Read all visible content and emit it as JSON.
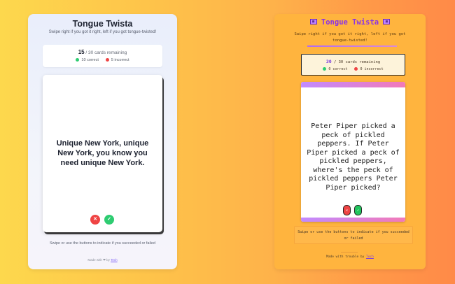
{
  "left": {
    "title": "Tongue Twista",
    "subtitle": "Swipe right if you got it right, left if you got tongue-twisted!",
    "stats": {
      "remaining_count": "15",
      "remaining_text": " / 30 cards remaining",
      "correct": "10 correct",
      "incorrect": "5 incorrect"
    },
    "card_text": "Unique New York, unique New York, you know you need unique New York.",
    "fail_symbol": "✕",
    "pass_symbol": "✓",
    "hint": "Swipe or use the buttons to indicate if you succeeded or failed",
    "footer_prefix": "Made with ",
    "footer_mid": "❤",
    "footer_text": " by ",
    "footer_link": "Tech"
  },
  "right": {
    "title": "Tongue Twista",
    "title_icon": "▦",
    "subtitle": "Swipe right if you got it right, left if you got tongue-twisted!",
    "progress": 1.0,
    "stats": {
      "remaining_count": "30",
      "remaining_text": " / 30 cards remaining",
      "correct": "0 correct",
      "incorrect": "0 incorrect"
    },
    "card_text": "Peter Piper picked a peck of pickled peppers. If Peter Piper picked a peck of pickled peppers, where's the peck of pickled peppers Peter Piper picked?",
    "fail_symbol": "✕",
    "pass_symbol": "✓",
    "hint": "Swipe or use the buttons to indicate if you succeeded or failed",
    "footer_text": "Made with trouble by ",
    "footer_link": "Tech"
  },
  "colors": {
    "accent_purple": "#8b32e6",
    "correct_green": "#2ecc71",
    "incorrect_red": "#ef4444"
  }
}
